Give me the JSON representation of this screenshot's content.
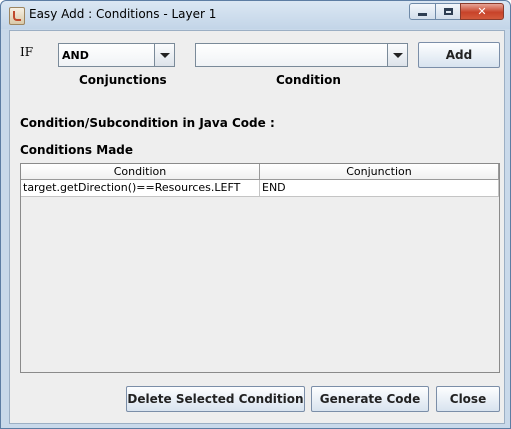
{
  "window": {
    "title": "Easy Add : Conditions - Layer 1"
  },
  "form": {
    "if_label": "IF",
    "conjunction_value": "AND",
    "conjunctions_label": "Conjunctions",
    "condition_value": "",
    "condition_label": "Condition",
    "add_label": "Add",
    "java_code_label": "Condition/Subcondition in Java Code :",
    "conditions_made_label": "Conditions Made"
  },
  "table": {
    "columns": [
      "Condition",
      "Conjunction"
    ],
    "rows": [
      [
        "target.getDirection()==Resources.LEFT",
        "END"
      ]
    ]
  },
  "buttons": {
    "delete": "Delete Selected Condition",
    "generate": "Generate Code",
    "close": "Close"
  }
}
